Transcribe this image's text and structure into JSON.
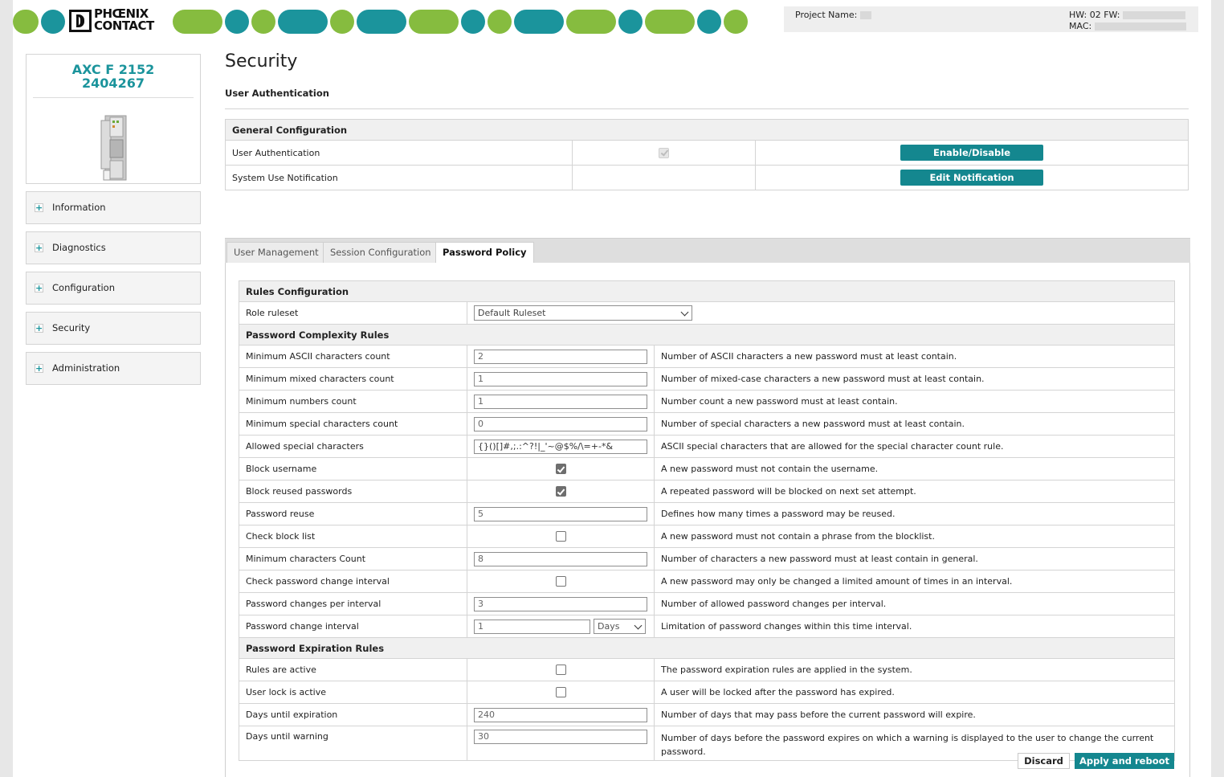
{
  "header": {
    "logo_line1": "PHŒNIX",
    "logo_line2": "CONTACT",
    "project_name_label": "Project Name:",
    "hw_fw_label": "HW: 02 FW:",
    "mac_label": "MAC:"
  },
  "device": {
    "model": "AXC F 2152",
    "order_number": "2404267"
  },
  "sidebar": {
    "items": [
      {
        "label": "Information"
      },
      {
        "label": "Diagnostics"
      },
      {
        "label": "Configuration"
      },
      {
        "label": "Security"
      },
      {
        "label": "Administration"
      }
    ]
  },
  "page": {
    "title": "Security",
    "subtitle": "User Authentication"
  },
  "general": {
    "header": "General Configuration",
    "rows": [
      {
        "label": "User Authentication",
        "button": "Enable/Disable"
      },
      {
        "label": "System Use Notification",
        "button": "Edit Notification"
      }
    ]
  },
  "tabs": [
    {
      "label": "User Management"
    },
    {
      "label": "Session Configuration"
    },
    {
      "label": "Password Policy"
    }
  ],
  "rules": {
    "header": "Rules Configuration",
    "role_ruleset_label": "Role ruleset",
    "role_ruleset_value": "Default Ruleset",
    "complexity_header": "Password Complexity Rules",
    "complexity": [
      {
        "label": "Minimum ASCII characters count",
        "value": "2",
        "desc": "Number of ASCII characters a new password must at least contain."
      },
      {
        "label": "Minimum mixed characters count",
        "value": "1",
        "desc": "Number of mixed-case characters a new password must at least contain."
      },
      {
        "label": "Minimum numbers count",
        "value": "1",
        "desc": "Number count a new password must at least contain."
      },
      {
        "label": "Minimum special characters count",
        "value": "0",
        "desc": "Number of special characters a new password must at least contain."
      },
      {
        "label": "Allowed special characters",
        "value": "{}()[]#,;.:^?!|_'~@$%/\\=+-*&",
        "desc": "ASCII special characters that are allowed for the special character count rule."
      },
      {
        "label": "Block username",
        "desc": "A new password must not contain the username."
      },
      {
        "label": "Block reused passwords",
        "desc": "A repeated password will be blocked on next set attempt."
      },
      {
        "label": "Password reuse",
        "value": "5",
        "desc": "Defines how many times a password may be reused."
      },
      {
        "label": "Check block list",
        "desc": "A new password must not contain a phrase from the blocklist."
      },
      {
        "label": "Minimum characters Count",
        "value": "8",
        "desc": "Number of characters a new password must at least contain in general."
      },
      {
        "label": "Check password change interval",
        "desc": "A new password may only be changed a limited amount of times in an interval."
      },
      {
        "label": "Password changes per interval",
        "value": "3",
        "desc": "Number of allowed password changes per interval."
      },
      {
        "label": "Password change interval",
        "value": "1",
        "unit": "Days",
        "desc": "Limitation of password changes within this time interval."
      }
    ],
    "expiration_header": "Password Expiration Rules",
    "expiration": [
      {
        "label": "Rules are active",
        "desc": "The password expiration rules are applied in the system."
      },
      {
        "label": "User lock is active",
        "desc": "A user will be locked after the password has expired."
      },
      {
        "label": "Days until expiration",
        "value": "240",
        "desc": "Number of days that may pass before the current password will expire."
      },
      {
        "label": "Days until warning",
        "value": "30",
        "desc": "Number of days before the password expires on which a warning is displayed to the user to change the current password."
      }
    ]
  },
  "actions": {
    "discard": "Discard",
    "apply": "Apply and reboot"
  },
  "colors": {
    "brand_green": "#86bc3f",
    "brand_teal": "#1b949c",
    "button_teal": "#14878f"
  }
}
